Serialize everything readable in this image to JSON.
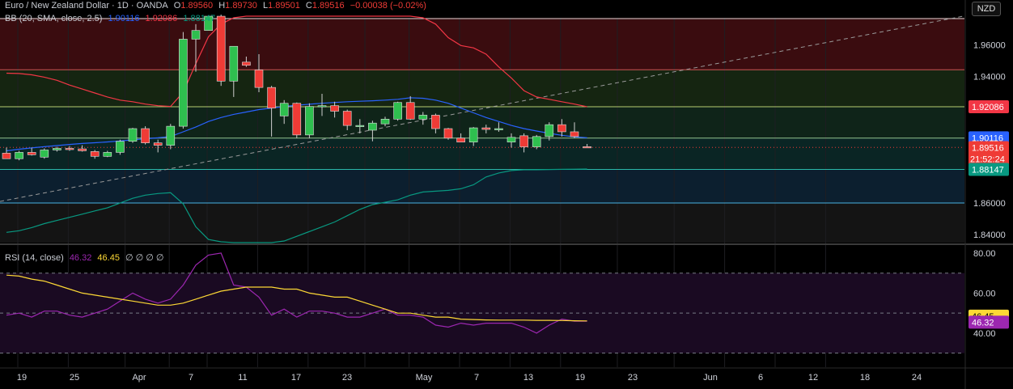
{
  "header": {
    "symbol": "Euro / New Zealand Dollar · 1D · OANDA",
    "o_label": "O",
    "o": "1.89560",
    "h_label": "H",
    "h": "1.89730",
    "l_label": "L",
    "l": "1.89501",
    "c_label": "C",
    "c": "1.89516",
    "change": "−0.00038 (−0.02%)"
  },
  "bb_legend": {
    "label": "BB (20, SMA, close, 2.5)",
    "basis": "1.90116",
    "upper": "1.92086",
    "lower": "1.88147"
  },
  "rsi_legend": {
    "label": "RSI (14, close)",
    "rsi": "46.32",
    "ma": "46.45",
    "extra": "∅ ∅ ∅ ∅"
  },
  "currency_badge": "NZD",
  "countdown": "21:52:24",
  "colors": {
    "up": "#26a69a",
    "up_fill": "#2fbf4f",
    "down": "#ef3b36",
    "bb_basis": "#2962ff",
    "bb_upper": "#f23645",
    "bb_lower": "#089981",
    "rsi": "#9c27b0",
    "rsi_ma": "#fdd835"
  },
  "chart_data": [
    {
      "type": "candlestick",
      "title": "Euro / New Zealand Dollar · 1D · OANDA",
      "y_axis_ticks": [
        "1.96000",
        "1.94000",
        "1.92000",
        "1.90000",
        "1.88000",
        "1.86000",
        "1.84000"
      ],
      "x_axis_ticks": [
        "19",
        "25",
        "Apr",
        "7",
        "11",
        "17",
        "23",
        "May",
        "7",
        "13",
        "19",
        "23",
        "Jun",
        "6",
        "12",
        "18",
        "24"
      ],
      "ylim": [
        1.835,
        1.977
      ],
      "price_labels": {
        "bb_upper": "1.92086",
        "bb_basis": "1.90116",
        "last": "1.89516",
        "bb_lower": "1.88147"
      },
      "candles": [
        {
          "o": 1.8915,
          "h": 1.895,
          "l": 1.888,
          "c": 1.888
        },
        {
          "o": 1.888,
          "h": 1.893,
          "l": 1.887,
          "c": 1.892
        },
        {
          "o": 1.892,
          "h": 1.895,
          "l": 1.89,
          "c": 1.8905
        },
        {
          "o": 1.889,
          "h": 1.8945,
          "l": 1.888,
          "c": 1.8935
        },
        {
          "o": 1.8935,
          "h": 1.8955,
          "l": 1.8925,
          "c": 1.8945
        },
        {
          "o": 1.8945,
          "h": 1.896,
          "l": 1.893,
          "c": 1.894
        },
        {
          "o": 1.8942,
          "h": 1.8965,
          "l": 1.8925,
          "c": 1.893
        },
        {
          "o": 1.8925,
          "h": 1.8935,
          "l": 1.888,
          "c": 1.8895
        },
        {
          "o": 1.8895,
          "h": 1.893,
          "l": 1.889,
          "c": 1.892
        },
        {
          "o": 1.892,
          "h": 1.9,
          "l": 1.8905,
          "c": 1.899
        },
        {
          "o": 1.899,
          "h": 1.9075,
          "l": 1.898,
          "c": 1.907
        },
        {
          "o": 1.907,
          "h": 1.9085,
          "l": 1.897,
          "c": 1.898
        },
        {
          "o": 1.898,
          "h": 1.9,
          "l": 1.892,
          "c": 1.8965
        },
        {
          "o": 1.8965,
          "h": 1.91,
          "l": 1.894,
          "c": 1.9085
        },
        {
          "o": 1.9085,
          "h": 1.968,
          "l": 1.907,
          "c": 1.9635
        },
        {
          "o": 1.9635,
          "h": 1.973,
          "l": 1.943,
          "c": 1.969
        },
        {
          "o": 1.969,
          "h": 1.978,
          "l": 1.974,
          "c": 1.978
        },
        {
          "o": 1.978,
          "h": 1.979,
          "l": 1.934,
          "c": 1.937
        },
        {
          "o": 1.937,
          "h": 1.959,
          "l": 1.927,
          "c": 1.959
        },
        {
          "o": 1.949,
          "h": 1.9525,
          "l": 1.946,
          "c": 1.947
        },
        {
          "o": 1.944,
          "h": 1.954,
          "l": 1.93,
          "c": 1.933
        },
        {
          "o": 1.933,
          "h": 1.934,
          "l": 1.902,
          "c": 1.92
        },
        {
          "o": 1.915,
          "h": 1.925,
          "l": 1.91,
          "c": 1.923
        },
        {
          "o": 1.923,
          "h": 1.9235,
          "l": 1.901,
          "c": 1.903
        },
        {
          "o": 1.903,
          "h": 1.923,
          "l": 1.901,
          "c": 1.921
        },
        {
          "o": 1.921,
          "h": 1.929,
          "l": 1.915,
          "c": 1.9215
        },
        {
          "o": 1.9215,
          "h": 1.924,
          "l": 1.914,
          "c": 1.918
        },
        {
          "o": 1.918,
          "h": 1.919,
          "l": 1.906,
          "c": 1.909
        },
        {
          "o": 1.909,
          "h": 1.913,
          "l": 1.904,
          "c": 1.909
        },
        {
          "o": 1.906,
          "h": 1.912,
          "l": 1.899,
          "c": 1.9105
        },
        {
          "o": 1.91,
          "h": 1.9145,
          "l": 1.9085,
          "c": 1.913
        },
        {
          "o": 1.913,
          "h": 1.924,
          "l": 1.912,
          "c": 1.9235
        },
        {
          "o": 1.9235,
          "h": 1.9275,
          "l": 1.9125,
          "c": 1.913
        },
        {
          "o": 1.913,
          "h": 1.9175,
          "l": 1.9095,
          "c": 1.9155
        },
        {
          "o": 1.9155,
          "h": 1.9165,
          "l": 1.904,
          "c": 1.907
        },
        {
          "o": 1.907,
          "h": 1.9075,
          "l": 1.9,
          "c": 1.901
        },
        {
          "o": 1.901,
          "h": 1.904,
          "l": 1.899,
          "c": 1.8985
        },
        {
          "o": 1.8985,
          "h": 1.908,
          "l": 1.896,
          "c": 1.9075
        },
        {
          "o": 1.9075,
          "h": 1.9095,
          "l": 1.904,
          "c": 1.9065
        },
        {
          "o": 1.9065,
          "h": 1.911,
          "l": 1.905,
          "c": 1.907
        },
        {
          "o": 1.8985,
          "h": 1.904,
          "l": 1.895,
          "c": 1.9015
        },
        {
          "o": 1.9025,
          "h": 1.904,
          "l": 1.892,
          "c": 1.8955
        },
        {
          "o": 1.8955,
          "h": 1.903,
          "l": 1.894,
          "c": 1.902
        },
        {
          "o": 1.902,
          "h": 1.911,
          "l": 1.8995,
          "c": 1.9095
        },
        {
          "o": 1.9095,
          "h": 1.913,
          "l": 1.902,
          "c": 1.905
        },
        {
          "o": 1.905,
          "h": 1.911,
          "l": 1.901,
          "c": 1.902
        },
        {
          "o": 1.8956,
          "h": 1.8973,
          "l": 1.895,
          "c": 1.8952
        }
      ],
      "bb_basis": [
        1.893,
        1.894,
        1.8948,
        1.8956,
        1.8963,
        1.897,
        1.8976,
        1.8981,
        1.8986,
        1.8992,
        1.8999,
        1.9006,
        1.9012,
        1.902,
        1.905,
        1.908,
        1.9115,
        1.914,
        1.916,
        1.9175,
        1.919,
        1.92,
        1.921,
        1.9218,
        1.9224,
        1.923,
        1.9235,
        1.924,
        1.9243,
        1.9246,
        1.925,
        1.9255,
        1.9265,
        1.9262,
        1.925,
        1.923,
        1.92,
        1.917,
        1.914,
        1.9115,
        1.909,
        1.907,
        1.9055,
        1.904,
        1.9028,
        1.9018,
        1.9012
      ],
      "bb_upper": [
        1.942,
        1.9418,
        1.941,
        1.9395,
        1.9375,
        1.9345,
        1.932,
        1.9295,
        1.927,
        1.925,
        1.924,
        1.9225,
        1.9215,
        1.921,
        1.93,
        1.948,
        1.965,
        1.973,
        1.977,
        1.978,
        1.978,
        1.978,
        1.978,
        1.978,
        1.978,
        1.978,
        1.978,
        1.978,
        1.978,
        1.978,
        1.978,
        1.978,
        1.978,
        1.977,
        1.973,
        1.9645,
        1.9595,
        1.958,
        1.954,
        1.946,
        1.939,
        1.931,
        1.927,
        1.9255,
        1.924,
        1.9225,
        1.9208
      ],
      "bb_lower": [
        1.8415,
        1.8425,
        1.8445,
        1.847,
        1.849,
        1.851,
        1.853,
        1.855,
        1.857,
        1.86,
        1.863,
        1.865,
        1.866,
        1.8665,
        1.8595,
        1.845,
        1.837,
        1.8355,
        1.835,
        1.835,
        1.835,
        1.835,
        1.836,
        1.839,
        1.842,
        1.845,
        1.848,
        1.852,
        1.856,
        1.859,
        1.8605,
        1.862,
        1.865,
        1.867,
        1.8675,
        1.868,
        1.869,
        1.8715,
        1.8765,
        1.879,
        1.8805,
        1.881,
        1.881,
        1.8812,
        1.8813,
        1.8814,
        1.8815
      ],
      "horizontal_levels": [
        1.9442,
        1.9208,
        1.901,
        1.8812,
        1.86
      ],
      "trendline": {
        "from": [
          0,
          1.861
        ],
        "to": [
          68,
          1.976
        ]
      }
    },
    {
      "type": "line",
      "title": "RSI (14, close)",
      "y_axis_ticks": [
        "80.00",
        "60.00",
        "40.00"
      ],
      "ylim": [
        23,
        82
      ],
      "levels": [
        70,
        50,
        30
      ],
      "series": [
        {
          "name": "RSI",
          "values": [
            49,
            50,
            48,
            51,
            51,
            49,
            48,
            50,
            52,
            56,
            60,
            57,
            55,
            57,
            64,
            74,
            79,
            80,
            64,
            63,
            58,
            49,
            52,
            48,
            51,
            51,
            50,
            48,
            48,
            50,
            52,
            49,
            49,
            48,
            44,
            43,
            45,
            44,
            45,
            45,
            45,
            43,
            40,
            44,
            47,
            46,
            46
          ]
        },
        {
          "name": "MA",
          "values": [
            69,
            68.5,
            67,
            66,
            64,
            62,
            60,
            59,
            58,
            57,
            56,
            55,
            54,
            54,
            55,
            57,
            59,
            61,
            62,
            63,
            63,
            63,
            62,
            62,
            60,
            59,
            58,
            58,
            56,
            54,
            52,
            50,
            50,
            49,
            48,
            48,
            47,
            46.8,
            46.6,
            46.5,
            46.5,
            46.5,
            46.4,
            46.4,
            46.3,
            46.2,
            46.1
          ]
        }
      ],
      "price_labels": {
        "ma": "46.45",
        "rsi": "46.32"
      }
    }
  ]
}
